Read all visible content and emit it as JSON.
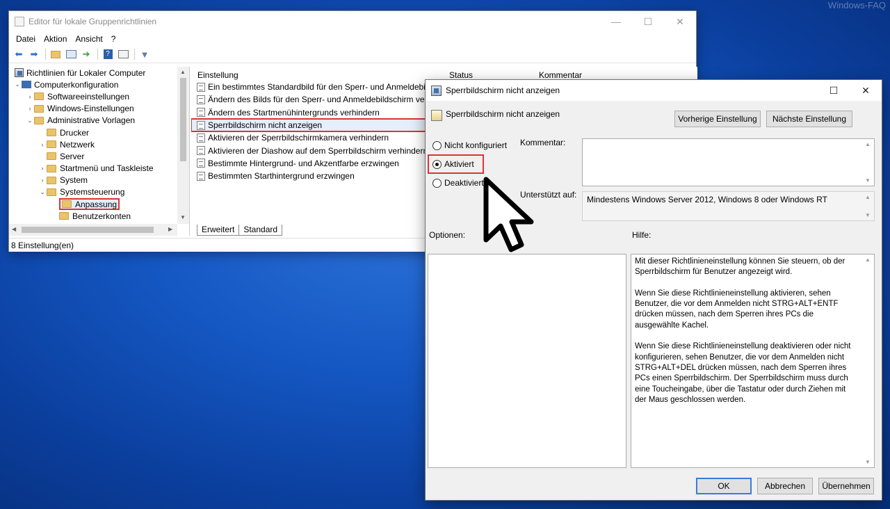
{
  "desktop": {
    "watermark": "Windows-FAQ"
  },
  "main_window": {
    "title": "Editor für lokale Gruppenrichtlinien",
    "menu": [
      "Datei",
      "Aktion",
      "Ansicht",
      "?"
    ],
    "tree": {
      "root": "Richtlinien für Lokaler Computer",
      "items": [
        "Computerkonfiguration",
        "Softwareeinstellungen",
        "Windows-Einstellungen",
        "Administrative Vorlagen",
        "Drucker",
        "Netzwerk",
        "Server",
        "Startmenü und Taskleiste",
        "System",
        "Systemsteuerung",
        "Anpassung",
        "Benutzerkonten"
      ],
      "selected": "Anpassung"
    },
    "list": {
      "columns": [
        "Einstellung",
        "Status",
        "Kommentar"
      ],
      "rows": [
        "Ein bestimmtes Standardbild für den Sperr- und Anmeldebild...",
        "Ändern des Bilds für den Sperr- und Anmeldebildschirm verh...",
        "Ändern des Startmenühintergrunds verhindern",
        "Sperrbildschirm nicht anzeigen",
        "Aktivieren der Sperrbildschirmkamera verhindern",
        "Aktivieren der Diashow auf dem Sperrbildschirm verhindern",
        "Bestimmte Hintergrund- und Akzentfarbe erzwingen",
        "Bestimmten Starthintergrund erzwingen"
      ],
      "selected_row": "Sperrbildschirm nicht anzeigen"
    },
    "tabs": [
      "Erweitert",
      "Standard"
    ],
    "status": "8 Einstellung(en)"
  },
  "dialog": {
    "title": "Sperrbildschirm nicht anzeigen",
    "policy_name": "Sperrbildschirm nicht anzeigen",
    "prev_button": "Vorherige Einstellung",
    "next_button": "Nächste Einstellung",
    "radio": {
      "not_configured": "Nicht konfiguriert",
      "enabled": "Aktiviert",
      "disabled": "Deaktiviert",
      "selected": "Aktiviert"
    },
    "comment_label": "Kommentar:",
    "supported_label": "Unterstützt auf:",
    "supported_value": "Mindestens Windows Server 2012, Windows 8 oder Windows RT",
    "options_label": "Optionen:",
    "help_label": "Hilfe:",
    "help_paragraphs": [
      "Mit dieser Richtlinieneinstellung können Sie steuern, ob der Sperrbildschirm für Benutzer angezeigt wird.",
      "Wenn Sie diese Richtlinieneinstellung aktivieren, sehen Benutzer, die vor dem Anmelden nicht STRG+ALT+ENTF drücken müssen, nach dem Sperren ihres PCs die ausgewählte Kachel.",
      "Wenn Sie diese Richtlinieneinstellung deaktivieren oder nicht konfigurieren, sehen Benutzer, die vor dem Anmelden nicht STRG+ALT+DEL drücken müssen, nach dem Sperren ihres PCs einen Sperrbildschirm. Der Sperrbildschirm muss durch eine Toucheingabe, über die Tastatur oder durch Ziehen mit der Maus geschlossen werden."
    ],
    "ok_button": "OK",
    "cancel_button": "Abbrechen",
    "apply_button": "Übernehmen"
  },
  "colors": {
    "highlight": "#d33333",
    "accent": "#3b7bd8"
  }
}
